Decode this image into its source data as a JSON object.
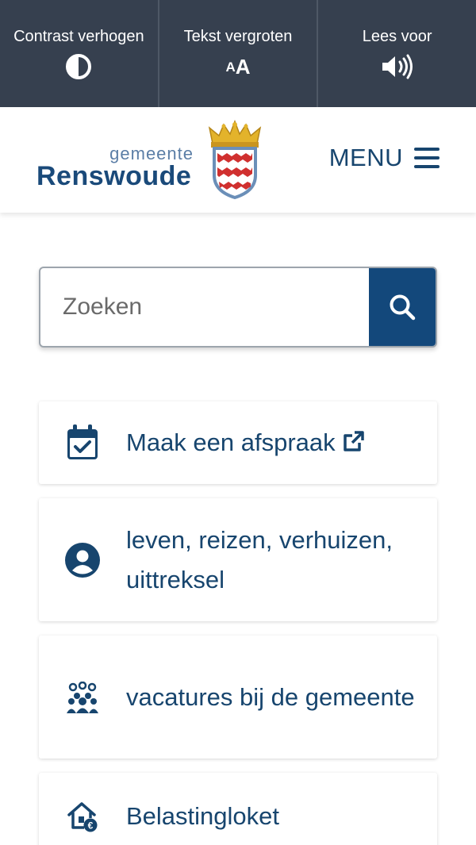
{
  "accessibility_bar": {
    "contrast_label": "Contrast verhogen",
    "text_size_label": "Tekst vergroten",
    "read_aloud_label": "Lees voor",
    "text_size_glyph_small": "A",
    "text_size_glyph_large": "A"
  },
  "header": {
    "logo_sub": "gemeente",
    "logo_main": "Renswoude",
    "menu_label": "MENU"
  },
  "search": {
    "placeholder": "Zoeken"
  },
  "tiles": [
    {
      "label": "Maak een afspraak",
      "icon": "calendar-check-icon",
      "external": true
    },
    {
      "label": "leven, reizen, verhuizen, uittreksel",
      "icon": "user-circle-icon",
      "external": false
    },
    {
      "label": "vacatures bij de gemeente",
      "icon": "people-group-icon",
      "external": false
    },
    {
      "label": "Belastingloket",
      "icon": "house-euro-icon",
      "external": false
    }
  ],
  "colors": {
    "a11y_bar": "#36404f",
    "primary": "#13487b",
    "text": "#17456e"
  }
}
